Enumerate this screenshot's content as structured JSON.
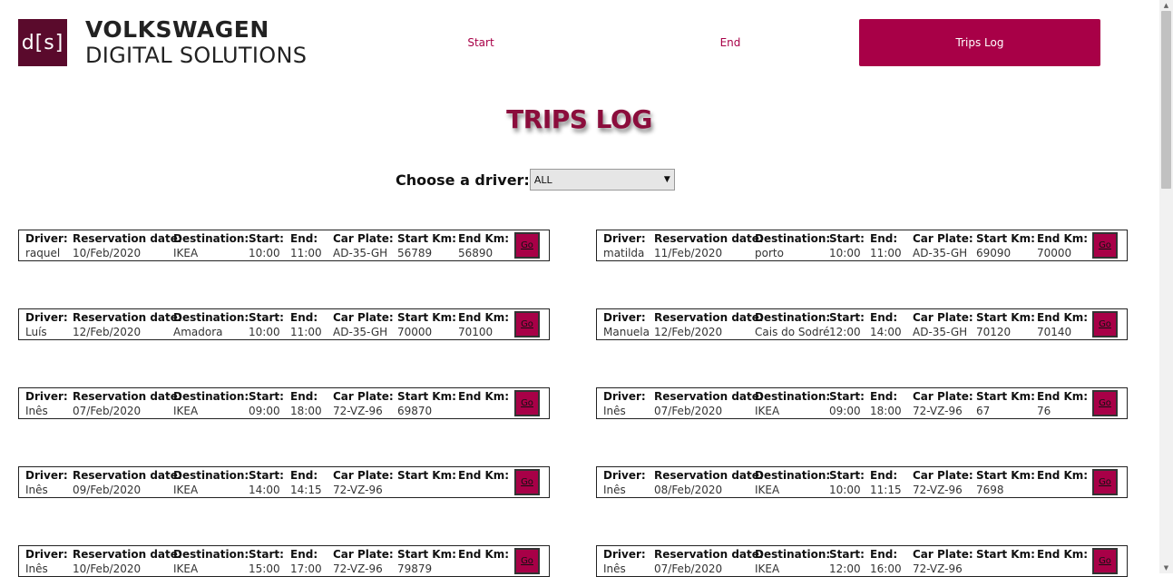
{
  "brand": {
    "badge": "d[s]",
    "line1": "VOLKSWAGEN",
    "line2": "DIGITAL SOLUTIONS",
    "color": "#5a0a2c"
  },
  "nav": {
    "start": "Start",
    "end": "End",
    "trips": "Trips Log",
    "accent": "#a80047"
  },
  "page": {
    "title": "TRIPS LOG",
    "driver_label": "Choose a driver:",
    "driver_selected": "ALL"
  },
  "labels": {
    "driver": "Driver:",
    "reservation": "Reservation date:",
    "destination": "Destination:",
    "start": "Start:",
    "end": "End:",
    "plate": "Car Plate:",
    "start_km": "Start Km:",
    "end_km": "End Km:",
    "go": "Go"
  },
  "trips_left": [
    {
      "driver": "raquel",
      "date": "10/Feb/2020",
      "destination": "IKEA",
      "start": "10:00",
      "end": "11:00",
      "plate": "AD-35-GH",
      "start_km": "56789",
      "end_km": "56890"
    },
    {
      "driver": "Luís",
      "date": "12/Feb/2020",
      "destination": "Amadora",
      "start": "10:00",
      "end": "11:00",
      "plate": "AD-35-GH",
      "start_km": "70000",
      "end_km": "70100"
    },
    {
      "driver": "Inês",
      "date": "07/Feb/2020",
      "destination": "IKEA",
      "start": "09:00",
      "end": "18:00",
      "plate": "72-VZ-96",
      "start_km": "69870",
      "end_km": ""
    },
    {
      "driver": "Inês",
      "date": "09/Feb/2020",
      "destination": "IKEA",
      "start": "14:00",
      "end": "14:15",
      "plate": "72-VZ-96",
      "start_km": "",
      "end_km": ""
    },
    {
      "driver": "Inês",
      "date": "10/Feb/2020",
      "destination": "IKEA",
      "start": "15:00",
      "end": "17:00",
      "plate": "72-VZ-96",
      "start_km": "79879",
      "end_km": ""
    }
  ],
  "trips_right": [
    {
      "driver": "matilda",
      "date": "11/Feb/2020",
      "destination": "porto",
      "start": "10:00",
      "end": "11:00",
      "plate": "AD-35-GH",
      "start_km": "69090",
      "end_km": "70000"
    },
    {
      "driver": "Manuela",
      "date": "12/Feb/2020",
      "destination": "Cais do Sodré",
      "start": "12:00",
      "end": "14:00",
      "plate": "AD-35-GH",
      "start_km": "70120",
      "end_km": "70140"
    },
    {
      "driver": "Inês",
      "date": "07/Feb/2020",
      "destination": "IKEA",
      "start": "09:00",
      "end": "18:00",
      "plate": "72-VZ-96",
      "start_km": "67",
      "end_km": "76"
    },
    {
      "driver": "Inês",
      "date": "08/Feb/2020",
      "destination": "IKEA",
      "start": "10:00",
      "end": "11:15",
      "plate": "72-VZ-96",
      "start_km": "7698",
      "end_km": ""
    },
    {
      "driver": "Inês",
      "date": "07/Feb/2020",
      "destination": "IKEA",
      "start": "12:00",
      "end": "16:00",
      "plate": "72-VZ-96",
      "start_km": "",
      "end_km": ""
    }
  ]
}
